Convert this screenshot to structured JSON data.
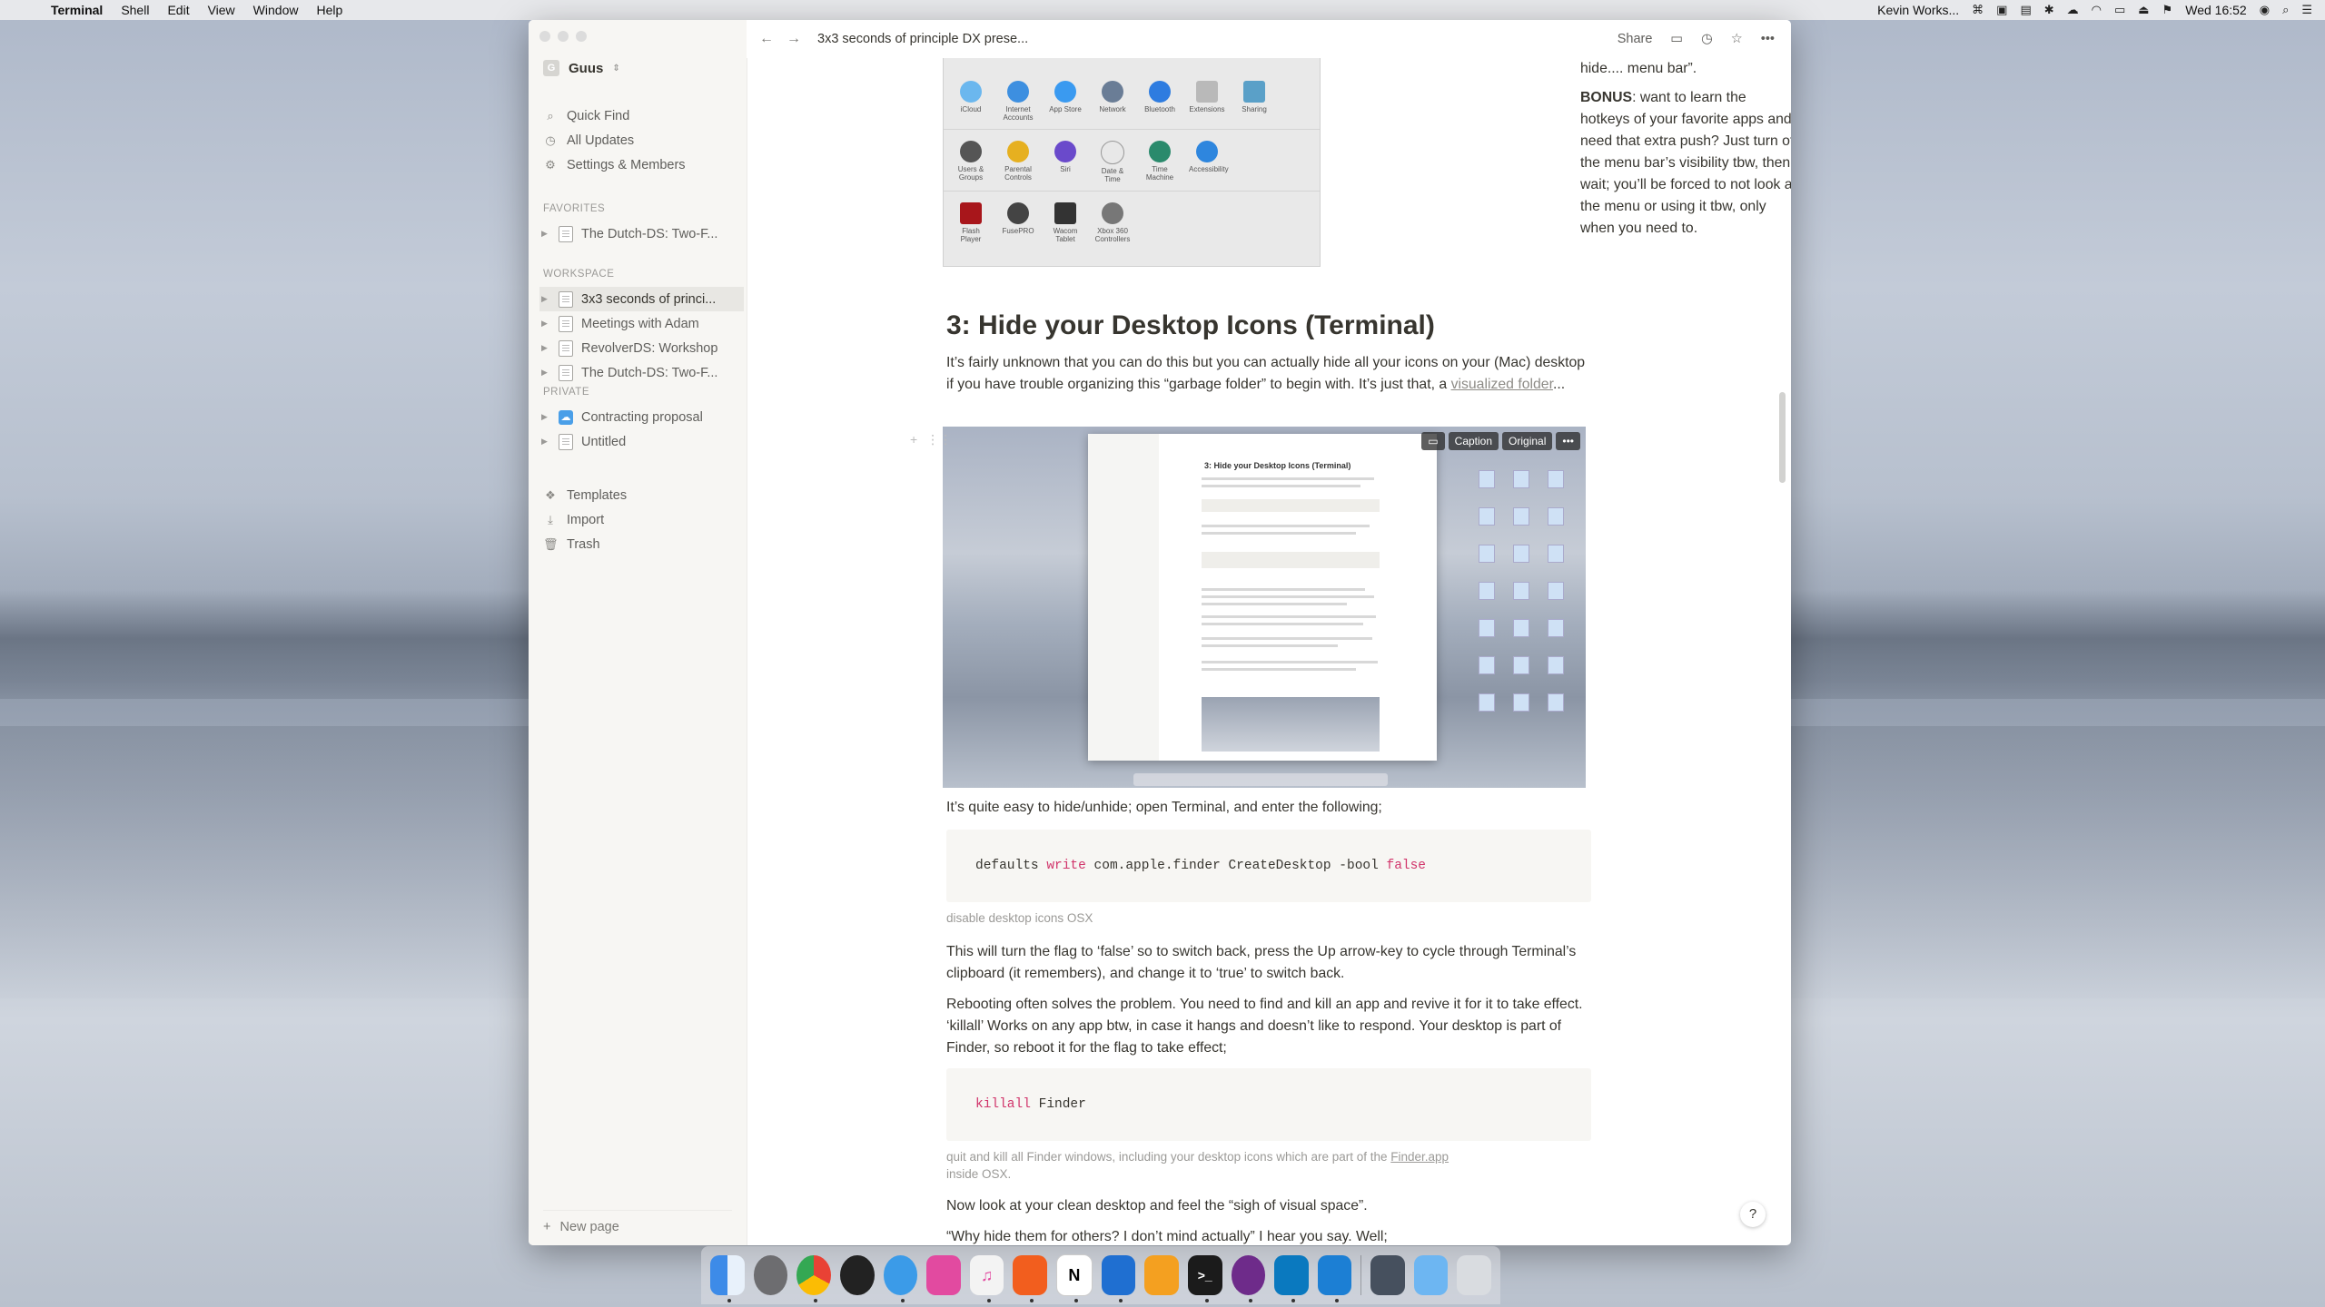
{
  "menubar": {
    "app": "Terminal",
    "items": [
      "Shell",
      "Edit",
      "View",
      "Window",
      "Help"
    ],
    "user": "Kevin Works...",
    "clock": "Wed 16:52"
  },
  "topbar": {
    "breadcrumb": "3x3 seconds of principle DX prese...",
    "share": "Share"
  },
  "sidebar": {
    "workspace": "Guus",
    "workspace_initial": "G",
    "nav": [
      "Quick Find",
      "All Updates",
      "Settings & Members"
    ],
    "favorites_label": "FAVORITES",
    "favorites": [
      "The Dutch-DS: Two-F..."
    ],
    "workspace_label": "WORKSPACE",
    "workspace_pages": [
      "3x3 seconds of princi...",
      "Meetings with Adam",
      "RevolverDS: Workshop",
      "The Dutch-DS: Two-F..."
    ],
    "private_label": "PRIVATE",
    "private_pages": [
      "Contracting proposal",
      "Untitled"
    ],
    "bottom": [
      "Templates",
      "Import",
      "Trash"
    ],
    "new_page": "New page"
  },
  "content": {
    "right_text_1": "...menu bar”.",
    "right_text_1a": "hide.... menu bar”.",
    "bonus_label": "BONUS",
    "bonus_text": ": want to learn the hotkeys of your favorite apps and need that extra push? Just turn of the menu bar’s visibility tbw, then wait; you’ll be forced to not look at the menu or using it tbw, only when you need to.",
    "heading": "3: Hide your Desktop Icons (Terminal)",
    "intro": "It’s fairly unknown that you can do this but you can actually hide all your icons on your (Mac) desktop if you have trouble organizing this “garbage folder” to begin with. It’s just that, a ",
    "intro_link": "visualized folder",
    "intro_end": "...",
    "image_toolbar": [
      "Caption",
      "Original"
    ],
    "easy": "It’s quite easy to hide/unhide; open Terminal, and enter the following;",
    "code1_a": "defaults ",
    "code1_kw1": "write",
    "code1_b": " com.apple.finder CreateDesktop -bool ",
    "code1_kw2": "false",
    "caption1": "disable desktop icons OSX",
    "flag_text": "This will turn the flag to ‘false’ so to switch back, press the Up arrow-key to cycle through Terminal’s clipboard (it remembers), and change it to ‘true’ to switch back.",
    "reboot_text": "Rebooting often solves the problem. You need to find and kill an app and revive it for it to take effect. ‘killall’ Works on any app btw, in case it hangs and doesn’t like to respond. Your desktop is part of Finder, so reboot it for the flag to take effect;",
    "code2_kw": "killall",
    "code2_b": " Finder",
    "caption2_a": "quit and kill all Finder windows, including your desktop icons which are part of the ",
    "caption2_link": "Finder.app",
    "caption2_b": "inside OSX.",
    "clean_text": "Now look at your clean desktop and feel the “sigh of visual space”.",
    "why_text": "“Why hide them for others? I don’t mind actually” I hear you say. Well;",
    "shot_title": "3: Hide your Desktop Icons (Terminal)",
    "help": "?"
  },
  "prefs_icons": [
    [
      "iCloud",
      "Internet Accounts",
      "App Store",
      "Network",
      "Bluetooth",
      "Extensions",
      "Sharing"
    ],
    [
      "Users & Groups",
      "Parental Controls",
      "Siri",
      "Date & Time",
      "Time Machine",
      "Accessibility"
    ],
    [
      "Flash Player",
      "FusePRO",
      "Wacom Tablet",
      "Xbox 360 Controllers"
    ]
  ],
  "colors": {
    "code_keyword": "#d1356b",
    "sidebar_bg": "#f7f6f3",
    "text": "#37352f"
  }
}
